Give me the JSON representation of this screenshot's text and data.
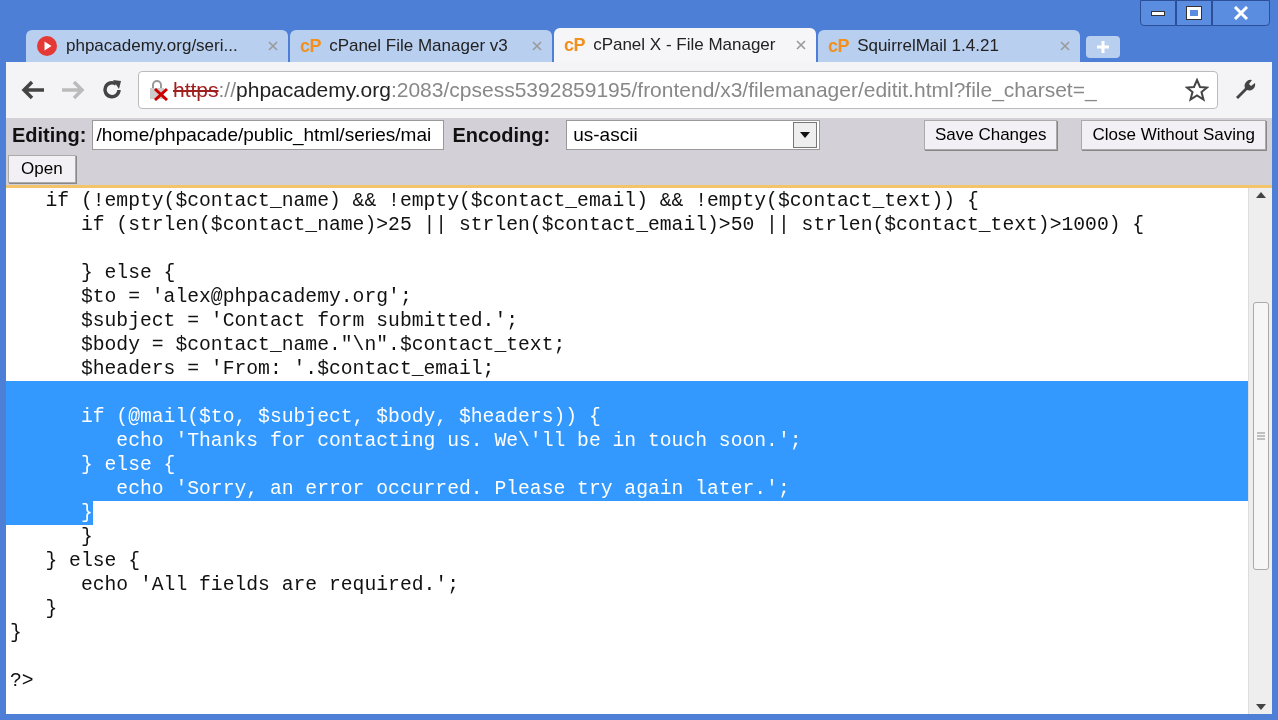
{
  "tabs": [
    {
      "kind": "play",
      "label": "phpacademy.org/seri...",
      "selected": false
    },
    {
      "kind": "cpanel",
      "icon_text": "cP",
      "label": "cPanel File Manager v3",
      "selected": false
    },
    {
      "kind": "cpanel",
      "icon_text": "cP",
      "label": "cPanel X - File Manager",
      "selected": true
    },
    {
      "kind": "cpanel",
      "icon_text": "cP",
      "label": "SquirrelMail 1.4.21",
      "selected": false
    }
  ],
  "address_bar": {
    "scheme": "https",
    "insecure": true,
    "separator": "://",
    "host": "phpacademy.org",
    "rest": ":2083/cpsess5392859195/frontend/x3/filemanager/editit.html?file_charset=_"
  },
  "editor_toolbar": {
    "editing_label": "Editing:",
    "editing_value": "/home/phpacade/public_html/series/mai",
    "encoding_label": "Encoding:",
    "encoding_value": "us-ascii",
    "save_button": "Save Changes",
    "close_button": "Close Without Saving",
    "open_button": "Open"
  },
  "code_lines": [
    {
      "text": "   if (!empty($contact_name) && !empty($contact_email) && !empty($contact_text)) {",
      "kind": "plain"
    },
    {
      "text": "      if (strlen($contact_name)>25 || strlen($contact_email)>50 || strlen($contact_text)>1000) {",
      "kind": "plain"
    },
    {
      "kind": "plain"
    },
    {
      "text": "      } else {",
      "kind": "plain"
    },
    {
      "text": "      $to = 'alex@phpacademy.org';",
      "kind": "plain"
    },
    {
      "text": "      $subject = 'Contact form submitted.';",
      "kind": "plain"
    },
    {
      "text": "      $body = $contact_name.\"\\n\".$contact_text;",
      "kind": "plain"
    },
    {
      "text": "      $headers = 'From: '.$contact_email;",
      "kind": "plain"
    },
    {
      "kind": "selected"
    },
    {
      "text": "      if (@mail($to, $subject, $body, $headers)) {",
      "kind": "selected"
    },
    {
      "text": "         echo 'Thanks for contacting us. We\\'ll be in touch soon.';",
      "kind": "selected"
    },
    {
      "text": "      } else {",
      "kind": "selected"
    },
    {
      "text": "         echo 'Sorry, an error occurred. Please try again later.';",
      "kind": "selected"
    },
    {
      "text": "      }",
      "kind": "selection_end"
    },
    {
      "text": "      }",
      "kind": "plain"
    },
    {
      "text": "   } else {",
      "kind": "plain"
    },
    {
      "text": "      echo 'All fields are required.';",
      "kind": "plain"
    },
    {
      "text": "   }",
      "kind": "plain"
    },
    {
      "text": "}",
      "kind": "plain"
    },
    {
      "kind": "plain"
    },
    {
      "text": "?>",
      "kind": "plain"
    }
  ]
}
